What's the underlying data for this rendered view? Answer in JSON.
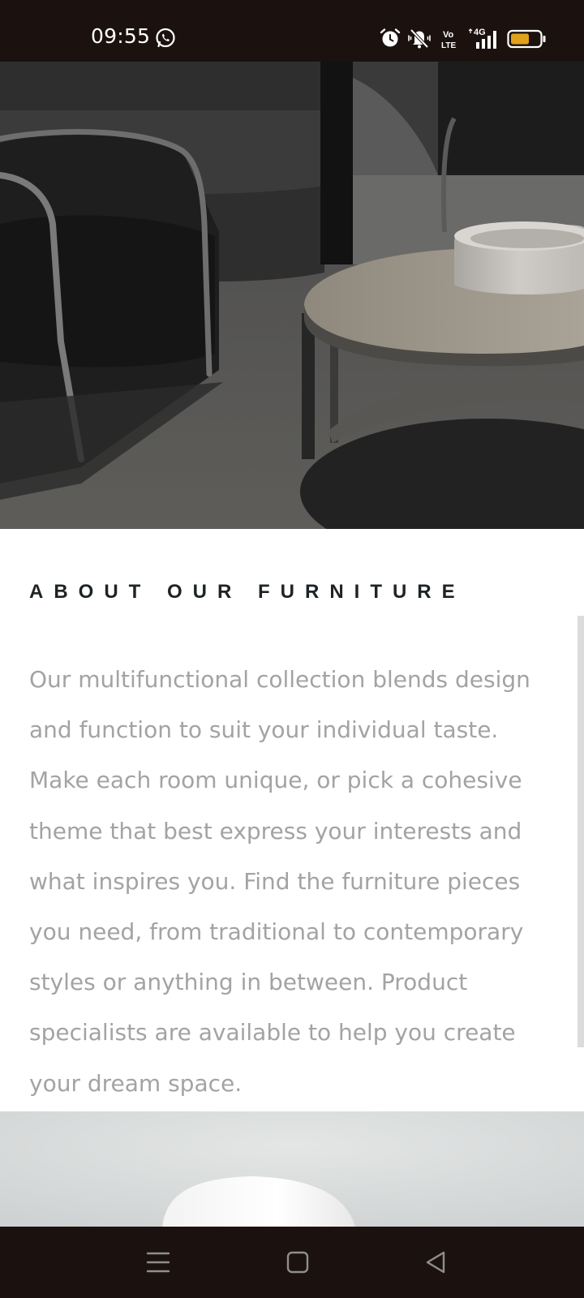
{
  "status_bar": {
    "time": "09:55",
    "network_label": "4G",
    "volte_label_top": "Vo",
    "volte_label_bottom": "LTE",
    "battery_color": "#e0a21c",
    "icons": [
      "whatsapp-icon",
      "alarm-icon",
      "mute-icon",
      "volte-icon",
      "signal-icon",
      "battery-icon"
    ]
  },
  "hero": {
    "image": "dark lounge chair and round wooden side table with stone bowl"
  },
  "about": {
    "heading": "ABOUT OUR FURNITURE",
    "paragraph": "Our multifunctional collection blends design and function to suit your individual taste. Make each room unique, or pick a cohesive theme that best express your interests and what inspires you. Find the furniture pieces you need, from traditional to contemporary styles or anything in between. Product specialists are available to help you create your dream space."
  },
  "nav_bar": {
    "buttons": [
      "menu-icon",
      "home-icon",
      "back-icon"
    ]
  },
  "colors": {
    "system_bar": "#1b1210",
    "heading": "#1e2326",
    "body_text": "#a3a3a3",
    "scrollbar": "#dcdcdc"
  }
}
